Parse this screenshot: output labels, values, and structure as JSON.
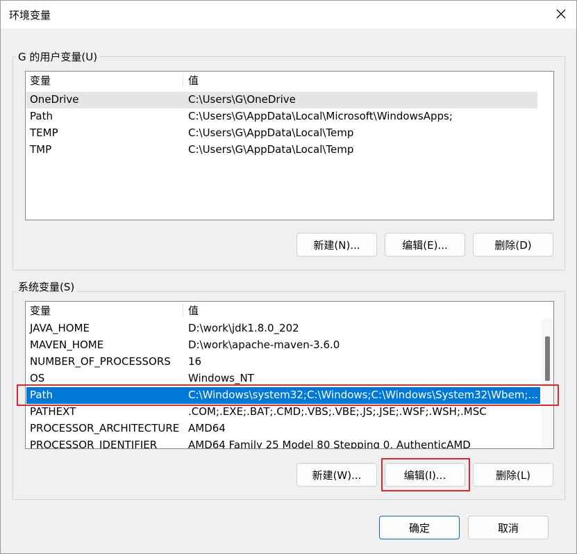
{
  "window": {
    "title": "环境变量"
  },
  "user_vars": {
    "group_label": "G 的用户变量(U)",
    "columns": [
      "变量",
      "值"
    ],
    "rows": [
      {
        "name": "OneDrive",
        "value": "C:\\Users\\G\\OneDrive"
      },
      {
        "name": "Path",
        "value": "C:\\Users\\G\\AppData\\Local\\Microsoft\\WindowsApps;"
      },
      {
        "name": "TEMP",
        "value": "C:\\Users\\G\\AppData\\Local\\Temp"
      },
      {
        "name": "TMP",
        "value": "C:\\Users\\G\\AppData\\Local\\Temp"
      }
    ],
    "buttons": {
      "new": "新建(N)...",
      "edit": "编辑(E)...",
      "delete": "删除(D)"
    }
  },
  "system_vars": {
    "group_label": "系统变量(S)",
    "columns": [
      "变量",
      "值"
    ],
    "rows": [
      {
        "name": "JAVA_HOME",
        "value": "D:\\work\\jdk1.8.0_202"
      },
      {
        "name": "MAVEN_HOME",
        "value": "D:\\work\\apache-maven-3.6.0"
      },
      {
        "name": "NUMBER_OF_PROCESSORS",
        "value": "16"
      },
      {
        "name": "OS",
        "value": "Windows_NT"
      },
      {
        "name": "Path",
        "value": "C:\\Windows\\system32;C:\\Windows;C:\\Windows\\System32\\Wbem;..."
      },
      {
        "name": "PATHEXT",
        "value": ".COM;.EXE;.BAT;.CMD;.VBS;.VBE;.JS;.JSE;.WSF;.WSH;.MSC"
      },
      {
        "name": "PROCESSOR_ARCHITECTURE",
        "value": "AMD64"
      },
      {
        "name": "PROCESSOR_IDENTIFIER",
        "value": "AMD64 Family 25 Model 80 Stepping 0, AuthenticAMD"
      }
    ],
    "selected_row": "Path",
    "buttons": {
      "new": "新建(W)...",
      "edit": "编辑(I)...",
      "delete": "删除(L)"
    }
  },
  "footer": {
    "ok": "确定",
    "cancel": "取消"
  },
  "colors": {
    "selection": "#0078d7",
    "highlight_box": "#e3262a",
    "default_button_border": "#0067c0"
  },
  "icons": {
    "close": "close-icon"
  }
}
